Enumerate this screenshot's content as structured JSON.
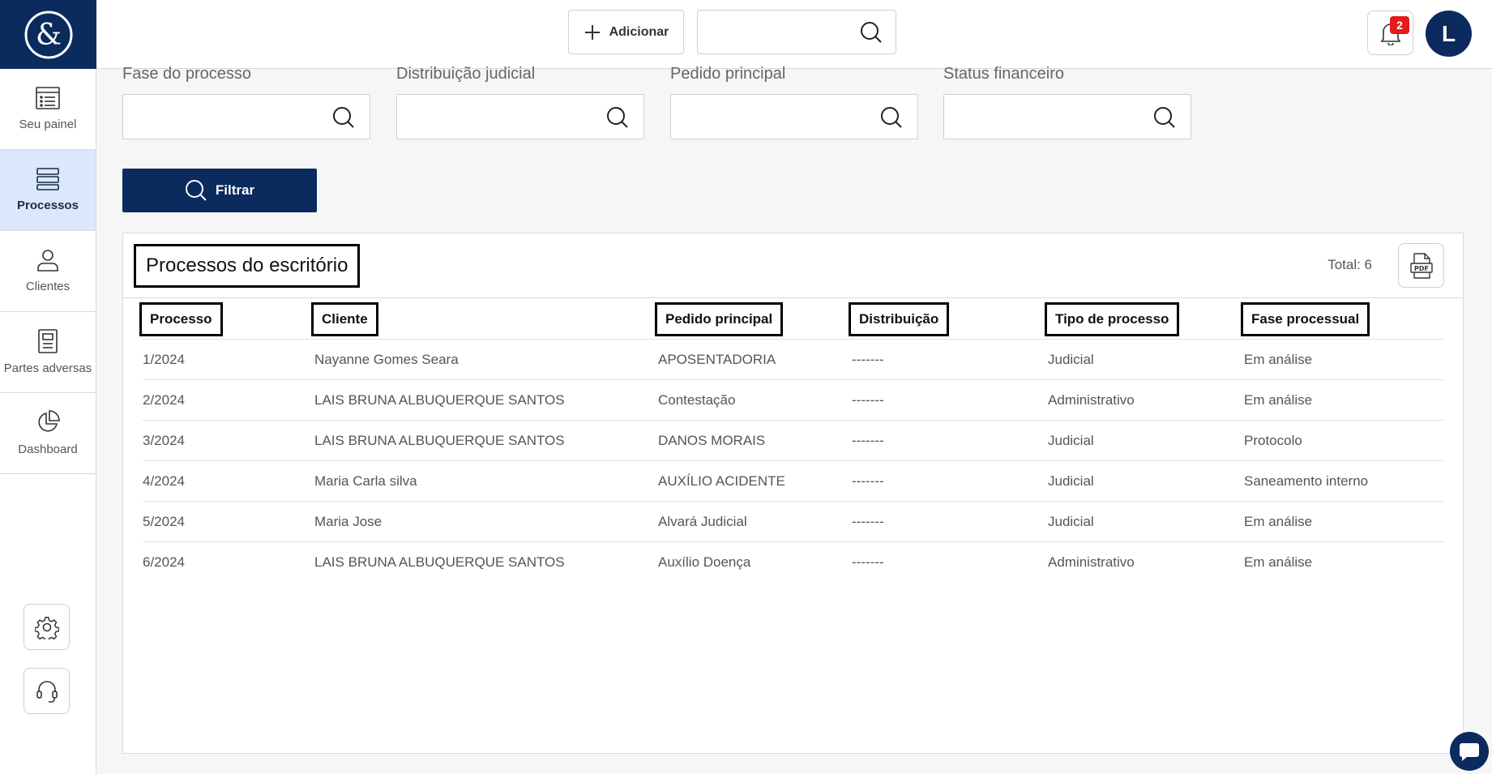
{
  "sidebar": {
    "items": [
      {
        "label": "Seu painel",
        "icon": "list-icon",
        "active": false
      },
      {
        "label": "Processos",
        "icon": "stack-icon",
        "active": true
      },
      {
        "label": "Clientes",
        "icon": "user-icon",
        "active": false
      },
      {
        "label": "Partes adversas",
        "icon": "document-icon",
        "active": false
      },
      {
        "label": "Dashboard",
        "icon": "pie-chart-icon",
        "active": false
      }
    ]
  },
  "header": {
    "add_label": "Adicionar",
    "search_value": "",
    "notifications_count": "2",
    "avatar_initial": "L"
  },
  "filters": {
    "fields": [
      {
        "label": "Fase do processo",
        "value": ""
      },
      {
        "label": "Distribuição judicial",
        "value": ""
      },
      {
        "label": "Pedido principal",
        "value": ""
      },
      {
        "label": "Status financeiro",
        "value": ""
      }
    ],
    "filter_label": "Filtrar"
  },
  "table": {
    "title": "Processos do escritório",
    "total": "Total: 6",
    "columns": [
      "Processo",
      "Cliente",
      "Pedido principal",
      "Distribuição",
      "Tipo de processo",
      "Fase processual"
    ],
    "rows": [
      [
        "1/2024",
        "Nayanne Gomes Seara",
        "APOSENTADORIA",
        "-------",
        "Judicial",
        "Em análise"
      ],
      [
        "2/2024",
        "LAIS BRUNA ALBUQUERQUE SANTOS",
        "Contestação",
        "-------",
        "Administrativo",
        "Em análise"
      ],
      [
        "3/2024",
        "LAIS BRUNA ALBUQUERQUE SANTOS",
        "DANOS MORAIS",
        "-------",
        "Judicial",
        "Protocolo"
      ],
      [
        "4/2024",
        "Maria Carla silva",
        "AUXÍLIO ACIDENTE",
        "-------",
        "Judicial",
        "Saneamento interno"
      ],
      [
        "5/2024",
        "Maria Jose",
        "Alvará Judicial",
        "-------",
        "Judicial",
        "Em análise"
      ],
      [
        "6/2024",
        "LAIS BRUNA ALBUQUERQUE SANTOS",
        "Auxílio Doença",
        "-------",
        "Administrativo",
        "Em análise"
      ]
    ]
  },
  "colors": {
    "brand": "#0b2a5e",
    "active_nav": "#dbe8fb",
    "badge": "#e21b1b"
  }
}
